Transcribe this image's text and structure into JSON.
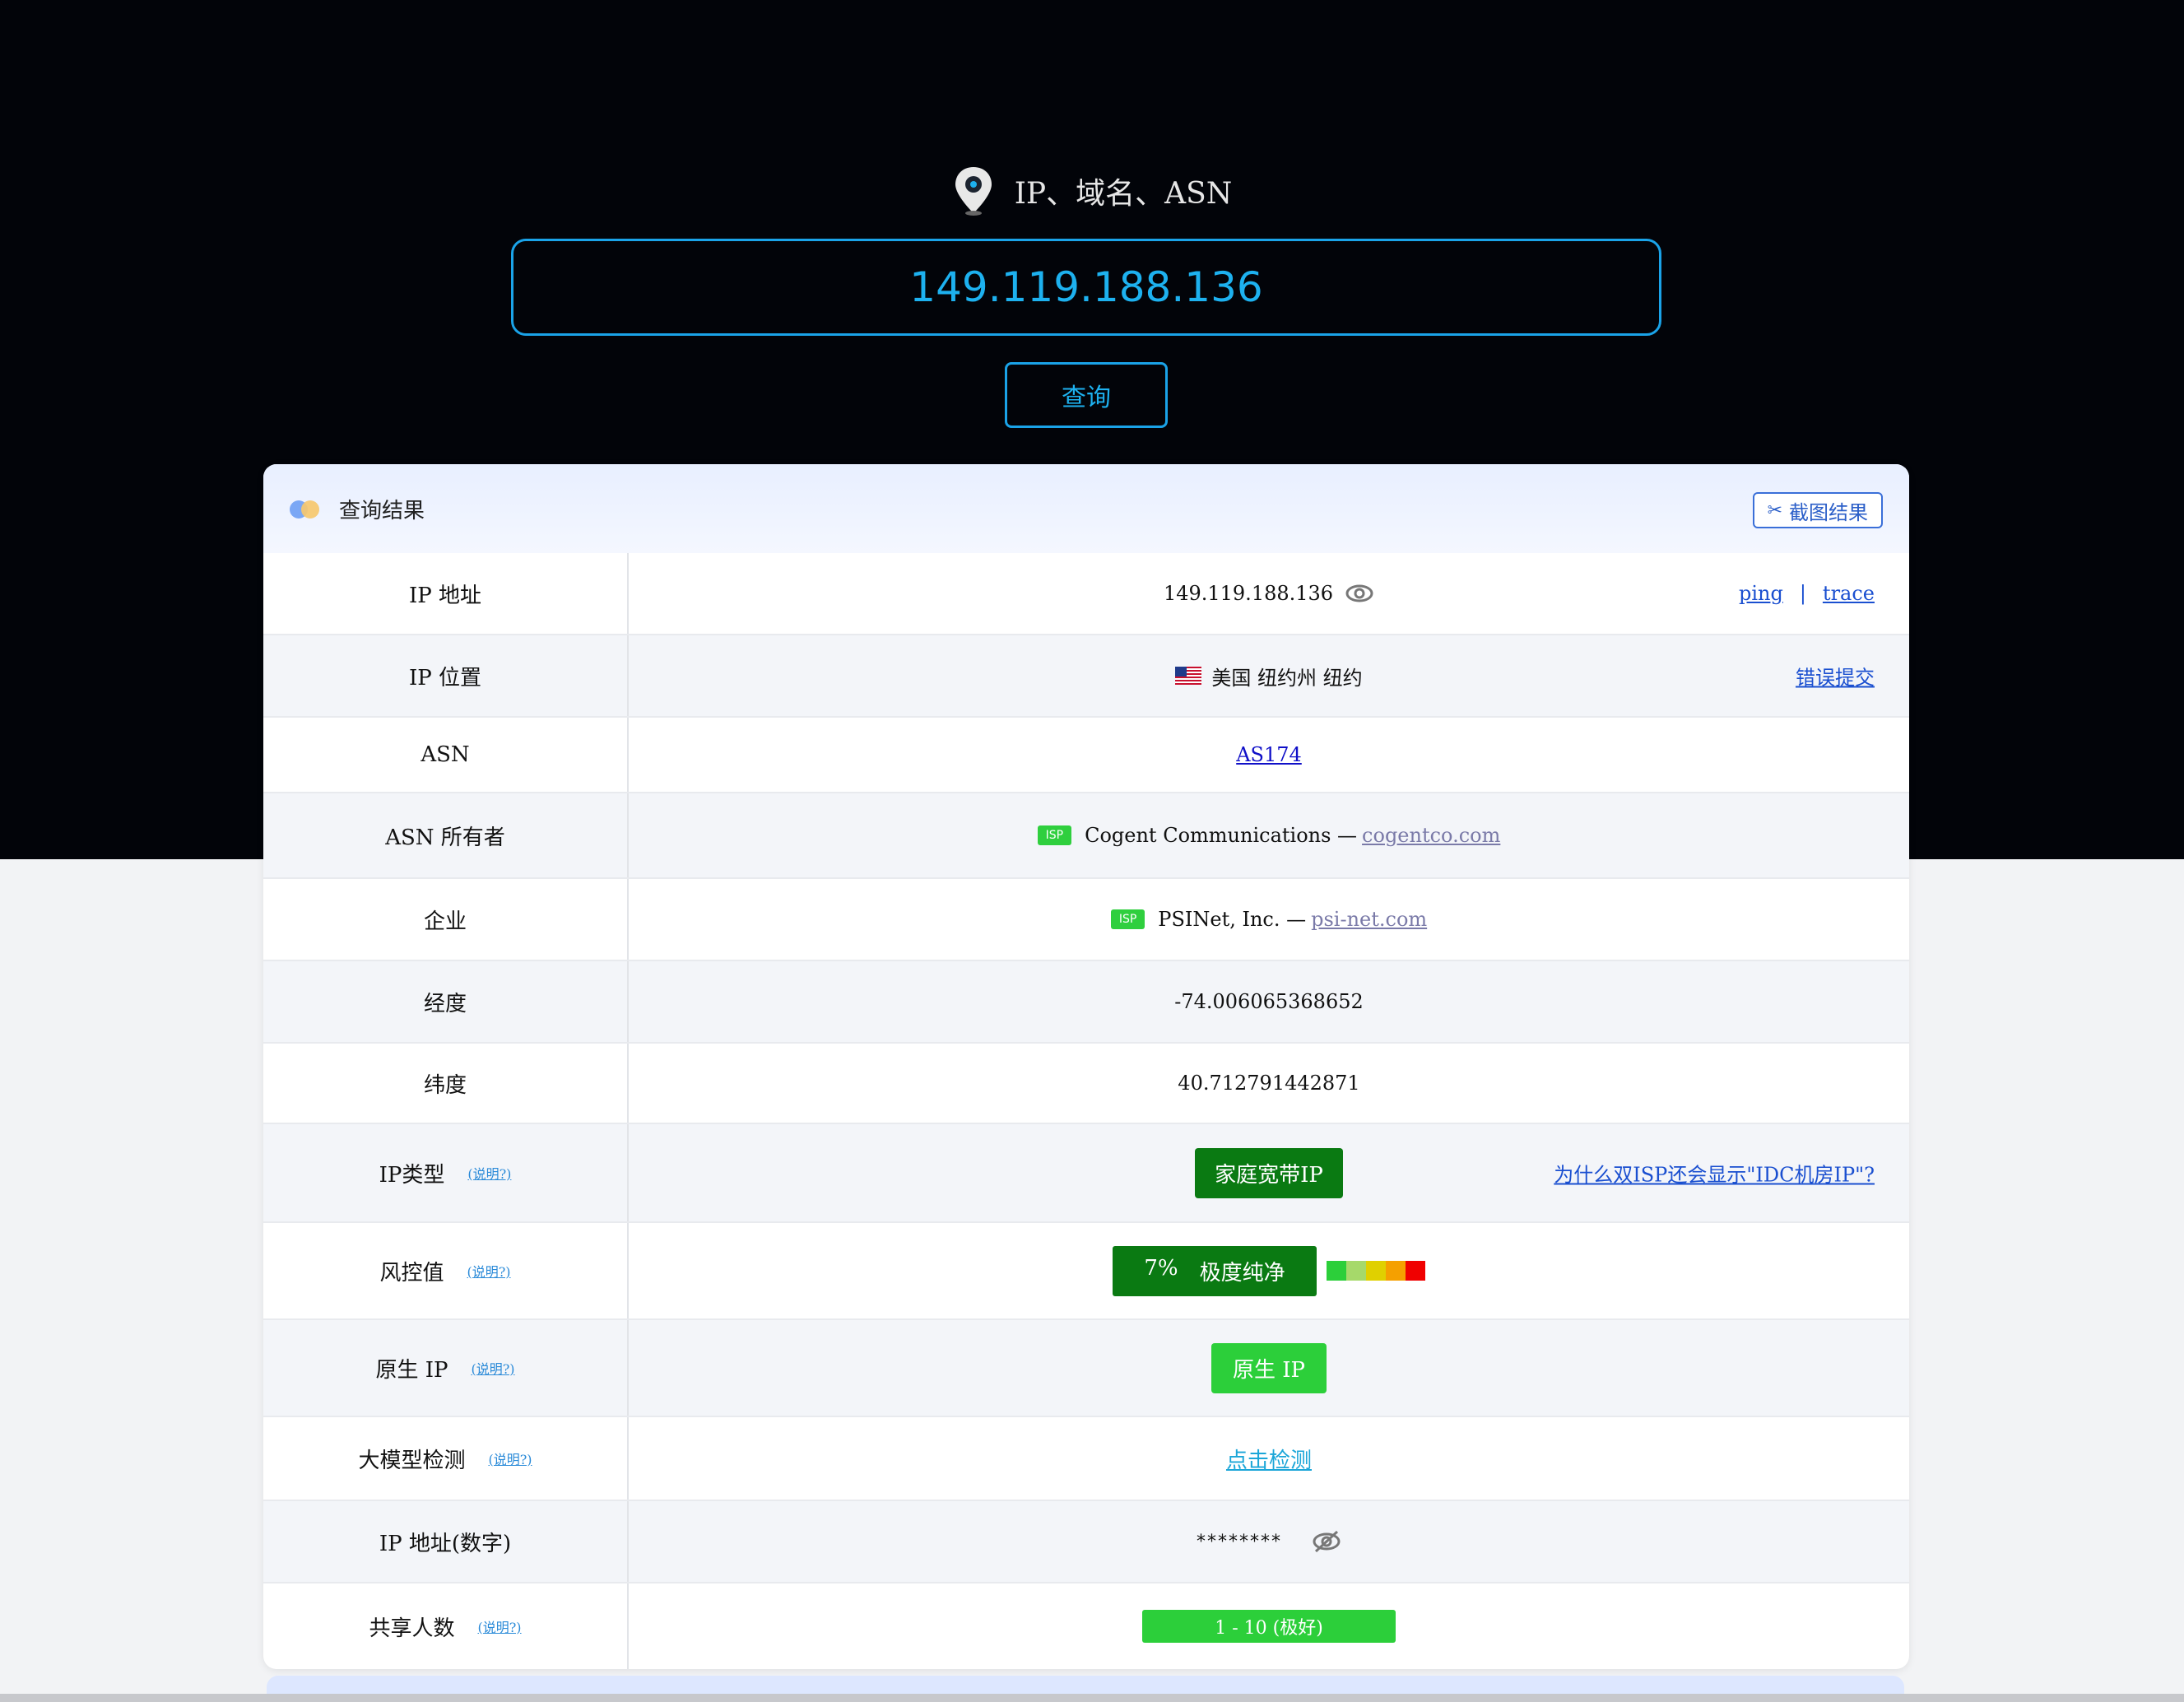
{
  "search": {
    "label": "IP、域名、ASN",
    "value": "149.119.188.136",
    "button_label": "查询"
  },
  "result": {
    "title": "查询结果",
    "screenshot_label": "截图结果",
    "rows": {
      "ip": {
        "label": "IP 地址",
        "value": "149.119.188.136",
        "ping": "ping",
        "sep": "|",
        "trace": "trace"
      },
      "location": {
        "label": "IP 位置",
        "value": "美国 纽约州 纽约",
        "report": "错误提交"
      },
      "asn": {
        "label": "ASN",
        "value": "AS174"
      },
      "asn_owner": {
        "label": "ASN 所有者",
        "badge": "ISP",
        "name": "Cogent Communications —",
        "domain": "cogentco.com"
      },
      "enterprise": {
        "label": "企业",
        "badge": "ISP",
        "name": "PSINet, Inc. —",
        "domain": "psi-net.com"
      },
      "longitude": {
        "label": "经度",
        "value": "-74.006065368652"
      },
      "latitude": {
        "label": "纬度",
        "value": "40.712791442871"
      },
      "ip_type": {
        "label": "IP类型",
        "help": "(说明?)",
        "value": "家庭宽带IP",
        "note": "为什么双ISP还会显示\"IDC机房IP\"?"
      },
      "risk": {
        "label": "风控值",
        "help": "(说明?)",
        "percent": "7%",
        "value": "极度纯净"
      },
      "native": {
        "label": "原生 IP",
        "help": "(说明?)",
        "value": "原生 IP"
      },
      "llm": {
        "label": "大模型检测",
        "help": "(说明?)",
        "value": "点击检测"
      },
      "ip_numeric": {
        "label": "IP 地址(数字)",
        "value": "********"
      },
      "share": {
        "label": "共享人数",
        "help": "(说明?)",
        "value": "1 - 10 (极好)"
      }
    }
  },
  "colors": {
    "accent": "#1db1ef",
    "dark_green": "#0a7a12",
    "green": "#2ccf3a",
    "risk_scale": [
      "#2ccf3a",
      "#a6d96a",
      "#e0d000",
      "#f5a000",
      "#f00000"
    ]
  },
  "icons": [
    "location-pin-icon",
    "eye-icon",
    "eye-off-icon",
    "scissors-icon",
    "us-flag-icon"
  ]
}
